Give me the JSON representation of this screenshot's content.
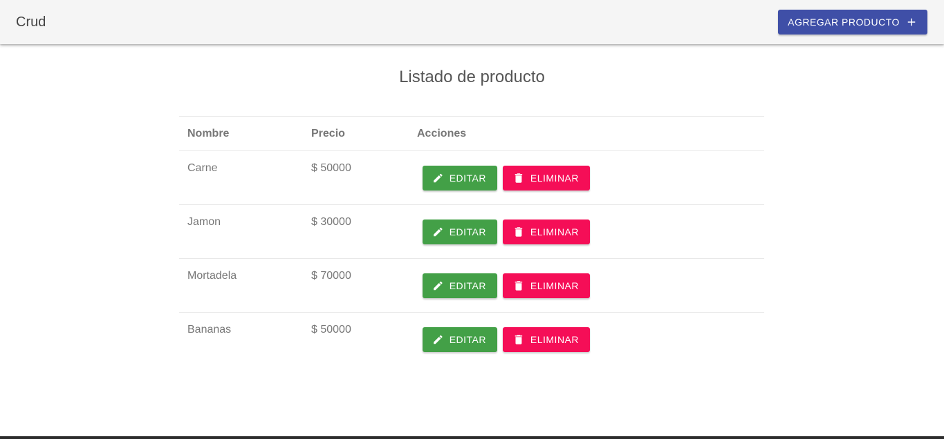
{
  "toolbar": {
    "brand": "Crud",
    "add_button_label": "AGREGAR PRODUCTO",
    "add_icon": "plus-icon"
  },
  "page": {
    "title": "Listado de producto"
  },
  "table": {
    "headers": {
      "nombre": "Nombre",
      "precio": "Precio",
      "acciones": "Acciones"
    },
    "rows": [
      {
        "nombre": "Carne",
        "precio": "$ 50000"
      },
      {
        "nombre": "Jamon",
        "precio": "$ 30000"
      },
      {
        "nombre": "Mortadela",
        "precio": "$ 70000"
      },
      {
        "nombre": "Bananas",
        "precio": "$ 50000"
      }
    ],
    "edit_label": "EDITAR",
    "delete_label": "ELIMINAR",
    "edit_icon": "pencil-icon",
    "delete_icon": "trash-icon"
  },
  "colors": {
    "primary": "#3f4fa7",
    "edit": "#43a047",
    "delete": "#f50e57",
    "toolbar_bg": "#f5f5f5"
  }
}
